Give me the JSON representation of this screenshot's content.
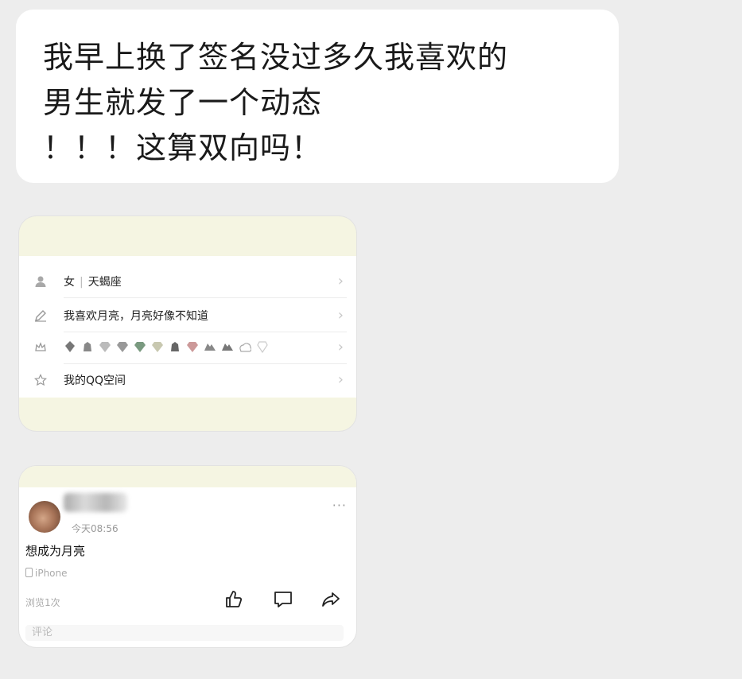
{
  "message": {
    "text": "我早上换了签名没过多久我喜欢的\n男生就发了一个动态\n！！！这算双向吗！"
  },
  "profile_card": {
    "gender": "女",
    "zodiac": "天蝎座",
    "signature": "我喜欢月亮，月亮好像不知道",
    "qzone": "我的QQ空间",
    "icons": [
      "person-icon",
      "pen-icon",
      "crown-icon",
      "star-icon"
    ]
  },
  "post_card": {
    "time": "今天08:56",
    "content": "想成为月亮",
    "device": "iPhone",
    "views": "浏览1次",
    "comment_placeholder": "评论",
    "more": "···"
  },
  "colors": {
    "background": "#ededed",
    "bubble": "#ffffff",
    "card_band": "#f5f5e2"
  }
}
